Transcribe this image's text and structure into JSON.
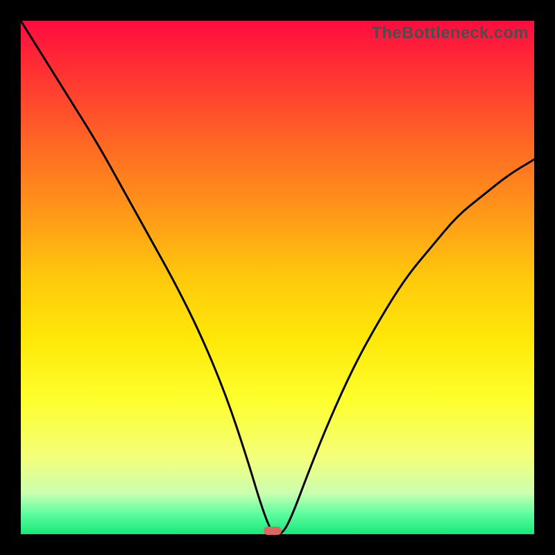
{
  "watermark": "TheBottleneck.com",
  "marker": {
    "x_pct": 49,
    "y_pct": 99.3
  },
  "chart_data": {
    "type": "line",
    "title": "",
    "xlabel": "",
    "ylabel": "",
    "xlim": [
      0,
      100
    ],
    "ylim": [
      0,
      100
    ],
    "series": [
      {
        "name": "curve",
        "x": [
          0,
          5,
          10,
          15,
          20,
          25,
          30,
          35,
          40,
          44,
          47,
          49,
          51,
          53,
          56,
          60,
          65,
          70,
          75,
          80,
          85,
          90,
          95,
          100
        ],
        "y": [
          100,
          92,
          84,
          76,
          67,
          58,
          49,
          39,
          27,
          15,
          5,
          0,
          0,
          4,
          12,
          22,
          33,
          42,
          50,
          56,
          62,
          66,
          70,
          73
        ]
      }
    ],
    "gradient_stops": [
      {
        "pct": 0,
        "color": "#ff0b3f"
      },
      {
        "pct": 12,
        "color": "#ff3a30"
      },
      {
        "pct": 25,
        "color": "#ff6b23"
      },
      {
        "pct": 38,
        "color": "#ff9a18"
      },
      {
        "pct": 50,
        "color": "#ffc90c"
      },
      {
        "pct": 62,
        "color": "#ffe808"
      },
      {
        "pct": 74,
        "color": "#fdff2e"
      },
      {
        "pct": 85,
        "color": "#f4ff7a"
      },
      {
        "pct": 92,
        "color": "#caffb0"
      },
      {
        "pct": 96,
        "color": "#5dfea0"
      },
      {
        "pct": 100,
        "color": "#17e87a"
      }
    ]
  }
}
